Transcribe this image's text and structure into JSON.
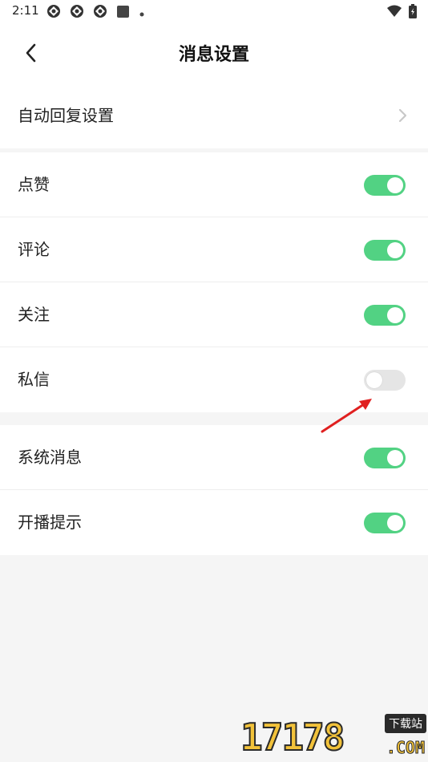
{
  "status_bar": {
    "time": "2:11",
    "icons": [
      "notification-icon",
      "notification-icon",
      "notification-icon",
      "square-icon",
      "dot-icon"
    ],
    "right_icons": [
      "wifi-icon",
      "battery-icon"
    ]
  },
  "nav": {
    "title": "消息设置",
    "back_icon": "chevron-left-icon"
  },
  "groups": [
    {
      "items": [
        {
          "label": "自动回复设置",
          "type": "link"
        }
      ]
    },
    {
      "items": [
        {
          "label": "点赞",
          "type": "toggle",
          "on": true
        },
        {
          "label": "评论",
          "type": "toggle",
          "on": true
        },
        {
          "label": "关注",
          "type": "toggle",
          "on": true
        },
        {
          "label": "私信",
          "type": "toggle",
          "on": false
        }
      ]
    },
    {
      "items": [
        {
          "label": "系统消息",
          "type": "toggle",
          "on": true
        },
        {
          "label": "开播提示",
          "type": "toggle",
          "on": true
        }
      ]
    }
  ],
  "colors": {
    "toggle_on": "#52d283",
    "toggle_off": "#e5e5e5",
    "annotation_arrow": "#e02020",
    "background": "#f5f5f5"
  },
  "watermark": {
    "number": "17178",
    "tag": "下载站",
    "suffix": ".COM"
  }
}
